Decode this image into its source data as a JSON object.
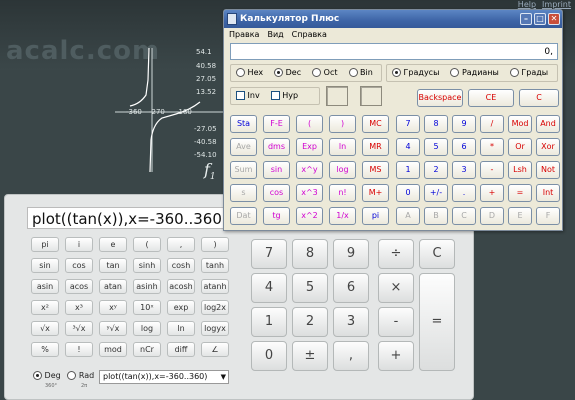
{
  "background": {
    "logo_text": "acalc.com",
    "links": [
      "Help",
      "Imprint"
    ],
    "graph": {
      "y_labels": [
        "54.1",
        "40.58",
        "27.05",
        "13.52",
        "-27.05",
        "-40.58",
        "-54.10"
      ],
      "x_labels": [
        "-360",
        "-270",
        "-180"
      ],
      "function_label": "f",
      "function_sub": "1"
    }
  },
  "calc_panel": {
    "expression": "plot((tan(x)),x=-360..360",
    "sci_rows": [
      [
        "pi",
        "i",
        "e",
        "(",
        ",",
        ")"
      ],
      [
        "sin",
        "cos",
        "tan",
        "sinh",
        "cosh",
        "tanh"
      ],
      [
        "asin",
        "acos",
        "atan",
        "asinh",
        "acosh",
        "atanh"
      ],
      [
        "x²",
        "x³",
        "xʸ",
        "10ˣ",
        "exp",
        "log2x"
      ],
      [
        "√x",
        "³√x",
        "ʸ√x",
        "log",
        "ln",
        "logyx"
      ],
      [
        "%",
        "!",
        "mod",
        "nCr",
        "diff",
        "∠"
      ]
    ],
    "num_keys": [
      [
        "7",
        "8",
        "9"
      ],
      [
        "4",
        "5",
        "6"
      ],
      [
        "1",
        "2",
        "3"
      ],
      [
        "0",
        "±",
        ","
      ]
    ],
    "op_keys": [
      "÷",
      "×",
      "-",
      "+"
    ],
    "clear_key": "C",
    "equals_key": "=",
    "angle_modes": [
      {
        "label": "Deg",
        "sub": "360°",
        "selected": true
      },
      {
        "label": "Rad",
        "sub": "2π",
        "selected": false
      }
    ],
    "history_value": "plot((tan(x)),x=-360..360)"
  },
  "win_calc": {
    "title": "Калькулятор Плюс",
    "menu": [
      "Правка",
      "Вид",
      "Справка"
    ],
    "display_value": "0,",
    "base_modes": [
      {
        "label": "Hex",
        "selected": false
      },
      {
        "label": "Dec",
        "selected": true
      },
      {
        "label": "Oct",
        "selected": false
      },
      {
        "label": "Bin",
        "selected": false
      }
    ],
    "angle_modes": [
      {
        "label": "Градусы",
        "selected": true
      },
      {
        "label": "Радианы",
        "selected": false
      },
      {
        "label": "Грады",
        "selected": false
      }
    ],
    "inv_label": "Inv",
    "hyp_label": "Hyp",
    "backspace_label": "Backspace",
    "ce_label": "CE",
    "c_label": "C",
    "buttons": {
      "row1": [
        "Sta",
        "F-E",
        "(",
        ")",
        "MC",
        "7",
        "8",
        "9",
        "/",
        "Mod",
        "And"
      ],
      "row2": [
        "Ave",
        "dms",
        "Exp",
        "ln",
        "MR",
        "4",
        "5",
        "6",
        "*",
        "Or",
        "Xor"
      ],
      "row3": [
        "Sum",
        "sin",
        "x^y",
        "log",
        "MS",
        "1",
        "2",
        "3",
        "-",
        "Lsh",
        "Not"
      ],
      "row4": [
        "s",
        "cos",
        "x^3",
        "n!",
        "M+",
        "0",
        "+/-",
        ".",
        "+",
        "=",
        "Int"
      ],
      "row5": [
        "Dat",
        "tg",
        "x^2",
        "1/x",
        "pi",
        "A",
        "B",
        "C",
        "D",
        "E",
        "F"
      ]
    }
  }
}
